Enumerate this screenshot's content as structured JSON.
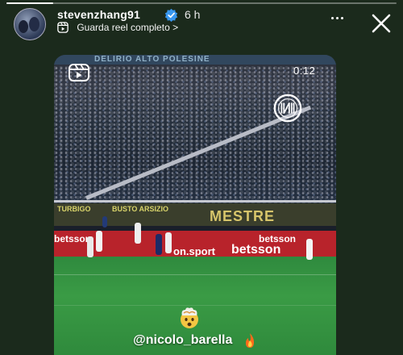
{
  "story": {
    "progress_fraction": 0.12,
    "username": "stevenzhang91",
    "time_ago": "6 h",
    "reel_link_label": "Guarda reel completo >",
    "more_icon": "more-dots-icon",
    "close_icon": "close-icon"
  },
  "video": {
    "timer": "0:12",
    "stadium_top_banner": "DELIRIO  ALTO POLESINE",
    "ad_mestre": "MESTRE",
    "ad_small_left": "TURBIGO",
    "ad_small_mid": "BUSTO ARSIZIO",
    "ad_red_left": "betsson",
    "ad_red_mid": "betsson",
    "ad_red_bottom_left": "on.sport",
    "ad_red_bottom_right": "betsson",
    "reel_icon": "reel-icon",
    "club_logo_icon": "inter-logo-icon"
  },
  "overlay": {
    "emoji": "exploding-head-emoji",
    "mention": "@nicolo_barella",
    "fire_icon": "fire-icon"
  },
  "colors": {
    "pitch_green": "#34923f",
    "adboard_red": "#b8232b",
    "verified_blue": "#3897f0"
  }
}
